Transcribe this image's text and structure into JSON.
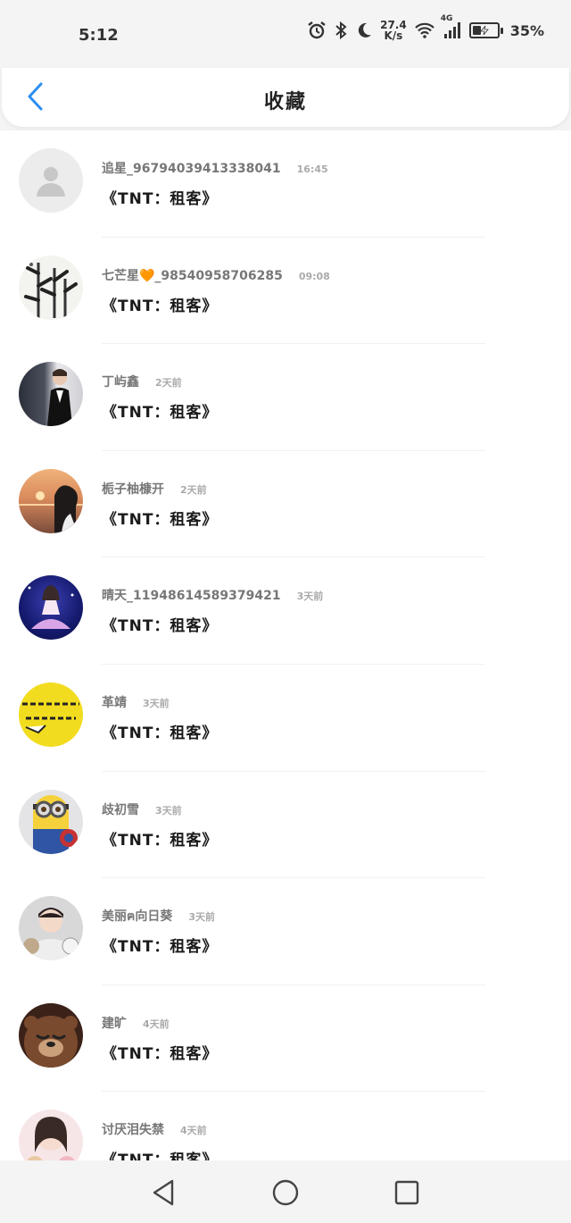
{
  "status_bar": {
    "time": "5:12",
    "net_speed_value": "27.4",
    "net_speed_unit": "K/s",
    "network_type": "4G",
    "battery_percent": "35%",
    "battery_level": 0.35
  },
  "header": {
    "title": "收藏",
    "back_icon": "chevron-left-icon",
    "accent_color": "#2a8df0"
  },
  "favorites": [
    {
      "username": "追星_96794039413338041",
      "time": "16:45",
      "book": "《TNT：租客》",
      "avatar": "default-avatar"
    },
    {
      "username": "七芒星🧡_98540958706285",
      "time": "09:08",
      "book": "《TNT：租客》",
      "avatar": "ink-bamboo-avatar"
    },
    {
      "username": "丁屿鑫",
      "time": "2天前",
      "book": "《TNT：租客》",
      "avatar": "person-photo-avatar"
    },
    {
      "username": "栀子柚槺开",
      "time": "2天前",
      "book": "《TNT：租客》",
      "avatar": "sunset-girl-avatar"
    },
    {
      "username": "晴天_11948614589379421",
      "time": "3天前",
      "book": "《TNT：租客》",
      "avatar": "stage-performer-avatar"
    },
    {
      "username": "革靖",
      "time": "3天前",
      "book": "《TNT：租客》",
      "avatar": "yellow-text-avatar"
    },
    {
      "username": "歧初雪",
      "time": "3天前",
      "book": "《TNT：租客》",
      "avatar": "minion-avatar"
    },
    {
      "username": "美丽ฅ向日葵",
      "time": "3天前",
      "book": "《TNT：租客》",
      "avatar": "boy-with-cats-avatar"
    },
    {
      "username": "建旷",
      "time": "4天前",
      "book": "《TNT：租客》",
      "avatar": "bear-avatar"
    },
    {
      "username": "讨厌泪失禁",
      "time": "4天前",
      "book": "《TNT：租客》",
      "avatar": "girl-with-bear-avatar"
    }
  ],
  "nav": {
    "back": "triangle-back-icon",
    "home": "circle-home-icon",
    "recents": "square-recents-icon"
  }
}
